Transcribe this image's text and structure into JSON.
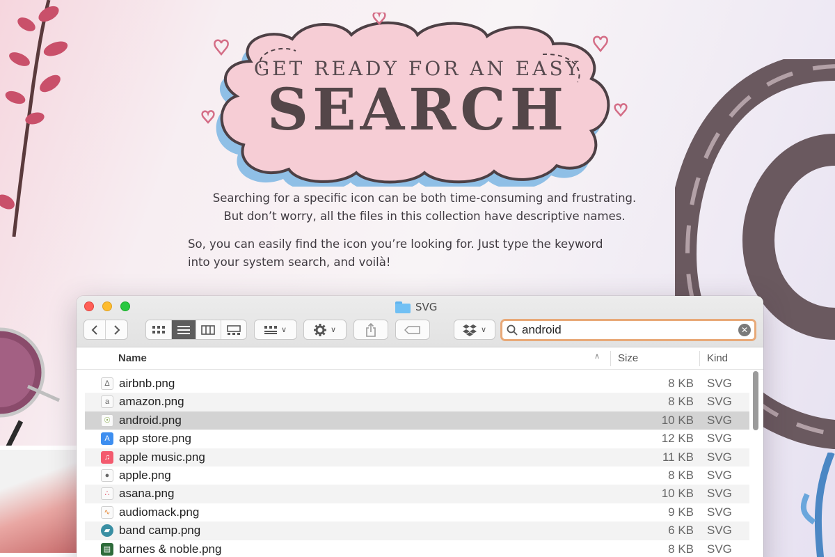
{
  "headline": {
    "line1": "GET READY FOR AN EASY",
    "line2": "SEARCH"
  },
  "description": {
    "paragraph1_line1": "Searching for a specific icon can be both time-consuming and frustrating.",
    "paragraph1_line2": "But don’t worry, all the files in this collection have descriptive names.",
    "paragraph2_line1": "So, you can easily find the icon you’re looking for. Just type the keyword",
    "paragraph2_line2": "into your system search, and voilà!"
  },
  "window": {
    "title": "SVG",
    "toolbar": {
      "icons": [
        "chevron-left-icon",
        "chevron-right-icon",
        "icon-view-icon",
        "list-view-icon",
        "column-view-icon",
        "gallery-view-icon",
        "group-icon",
        "gear-icon",
        "share-icon",
        "tag-icon",
        "dropbox-icon"
      ],
      "active_view": "list"
    },
    "search": {
      "value": "android",
      "accent_color": "#e8a978"
    },
    "columns": {
      "name": "Name",
      "size": "Size",
      "kind": "Kind"
    },
    "files": [
      {
        "name": "airbnb.png",
        "size": "8 KB",
        "kind": "SVG",
        "icon": "airbnb-icon"
      },
      {
        "name": "amazon.png",
        "size": "8 KB",
        "kind": "SVG",
        "icon": "amazon-icon"
      },
      {
        "name": "android.png",
        "size": "10 KB",
        "kind": "SVG",
        "icon": "android-icon",
        "selected": true
      },
      {
        "name": "app store.png",
        "size": "12 KB",
        "kind": "SVG",
        "icon": "app-store-icon"
      },
      {
        "name": "apple music.png",
        "size": "11 KB",
        "kind": "SVG",
        "icon": "apple-music-icon"
      },
      {
        "name": "apple.png",
        "size": "8 KB",
        "kind": "SVG",
        "icon": "apple-icon"
      },
      {
        "name": "asana.png",
        "size": "10 KB",
        "kind": "SVG",
        "icon": "asana-icon"
      },
      {
        "name": "audiomack.png",
        "size": "9 KB",
        "kind": "SVG",
        "icon": "audiomack-icon"
      },
      {
        "name": "band camp.png",
        "size": "6 KB",
        "kind": "SVG",
        "icon": "bandcamp-icon"
      },
      {
        "name": "barnes & noble.png",
        "size": "8 KB",
        "kind": "SVG",
        "icon": "barnes-noble-icon"
      }
    ]
  },
  "colors": {
    "headline_text": "#544649",
    "cloud_fill": "#f6cdd5",
    "cloud_shadow": "#8fbfe6",
    "selected_row": "#d3d3d3"
  }
}
